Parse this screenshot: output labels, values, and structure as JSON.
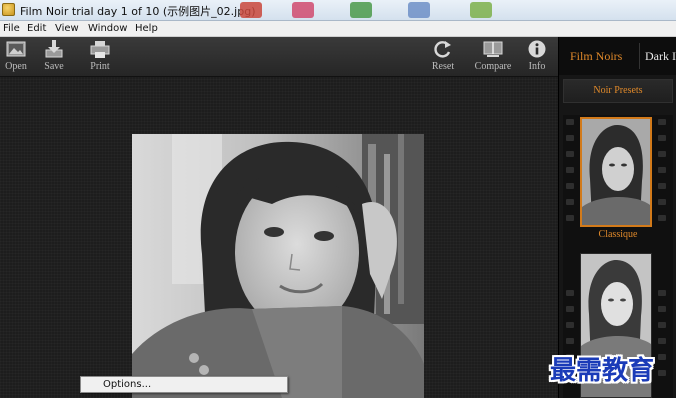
{
  "window": {
    "title": "Film Noir trial day 1 of 10 (示例图片_02.jpg)"
  },
  "menu": {
    "items": [
      "File",
      "Edit",
      "View",
      "Window",
      "Help"
    ]
  },
  "toolbar": {
    "open_label": "Open",
    "save_label": "Save",
    "print_label": "Print",
    "reset_label": "Reset",
    "compare_label": "Compare",
    "info_label": "Info"
  },
  "panel": {
    "tab_active": "Film Noirs",
    "tab_inactive": "Dark I",
    "presets_label": "Noir Presets",
    "selected_preset": "Classique"
  },
  "popup": {
    "item": "Options..."
  },
  "watermark": "最需教育",
  "colors": {
    "accent": "#e0892a",
    "toolbar_bg": "#2e2e2e",
    "canvas_bg": "#1d1d1d"
  },
  "icons": [
    "open-icon",
    "save-icon",
    "print-icon",
    "reset-icon",
    "compare-icon",
    "info-icon"
  ]
}
